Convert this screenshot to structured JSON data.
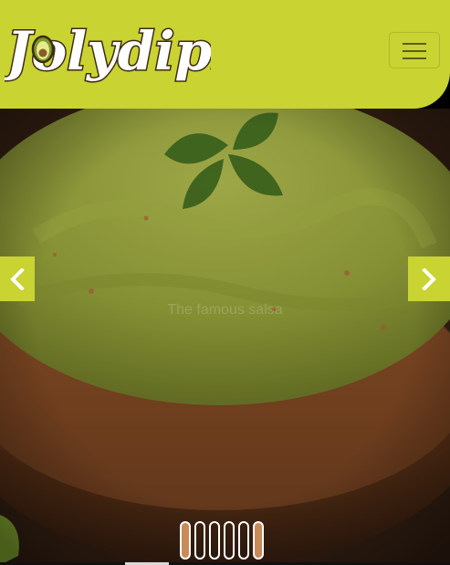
{
  "brand": {
    "name": "Jolydips",
    "logo_text": "Jolydips",
    "color": "#c9d332"
  },
  "header": {
    "menu_icon": "hamburger-icon"
  },
  "carousel": {
    "caption_title": "",
    "caption_subtitle": "The famous salsa",
    "prev_icon": "chevron-left-icon",
    "next_icon": "chevron-right-icon",
    "slide_count": 6,
    "active_index": 0
  }
}
